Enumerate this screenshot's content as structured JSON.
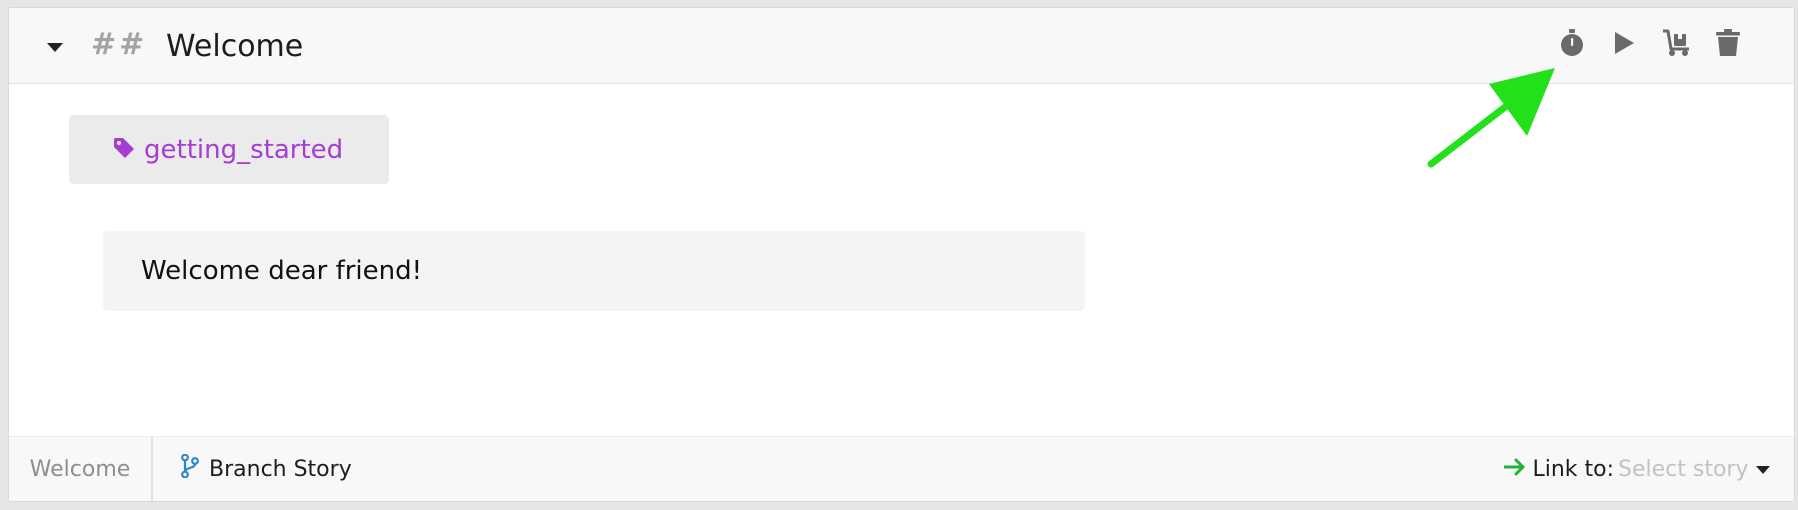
{
  "header": {
    "heading_marker": "##",
    "title": "Welcome",
    "actions": [
      {
        "name": "timer",
        "icon": "stopwatch-icon"
      },
      {
        "name": "play",
        "icon": "play-icon"
      },
      {
        "name": "cart",
        "icon": "dolly-icon"
      },
      {
        "name": "delete",
        "icon": "trash-icon"
      }
    ],
    "collapse_icon": "caret-down-icon"
  },
  "tag": {
    "icon": "tag-icon",
    "label": "getting_started"
  },
  "utterance": {
    "text": "Welcome dear friend!"
  },
  "footer": {
    "story_name": "Welcome",
    "branch_label": "Branch Story",
    "branch_icon": "branch-icon",
    "link_label": "Link to:",
    "link_icon": "arrow-right-icon",
    "select_placeholder": "Select story",
    "select_icon": "caret-down-icon"
  },
  "colors": {
    "tag": "#a73ed3",
    "arrow_annotation": "#22e11a",
    "branch_icon": "#2a86c9",
    "link_arrow": "#23b13a",
    "icon_gray": "#6a6a6a"
  }
}
